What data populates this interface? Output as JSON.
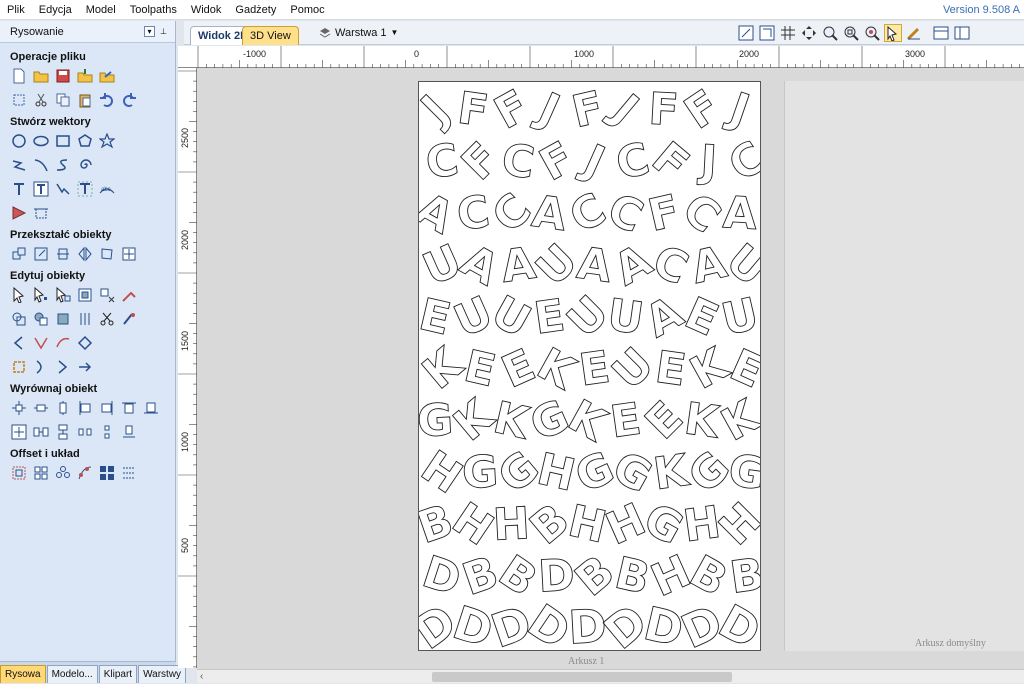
{
  "menu": {
    "items": [
      "Plik",
      "Edycja",
      "Model",
      "Toolpaths",
      "Widok",
      "Gadżety",
      "Pomoc"
    ],
    "version": "Version 9.508 A"
  },
  "panel": {
    "title": "Rysowanie",
    "sections": [
      {
        "title": "Operacje pliku"
      },
      {
        "title": "Stwórz wektory"
      },
      {
        "title": "Przekształć obiekty"
      },
      {
        "title": "Edytuj obiekty"
      },
      {
        "title": "Wyrównaj obiekt"
      },
      {
        "title": "Offset i układ"
      }
    ],
    "tabs": [
      "Rysowa",
      "Modelo...",
      "Klipart",
      "Warstwy"
    ]
  },
  "view": {
    "tab_2d": "Widok 2D",
    "tab_3d": "3D View",
    "layer": "Warstwa 1"
  },
  "ruler": {
    "h_labels": [
      "-1000",
      "0",
      "1000",
      "2000",
      "3000"
    ],
    "v_labels": [
      "2500",
      "2000",
      "1500",
      "1000",
      "500"
    ]
  },
  "canvas": {
    "sheet1": "Arkusz 1",
    "sheet_default": "Arkusz domyślny",
    "letter_rows": [
      "JFFJFJFFJ",
      "CFCFJCFJC",
      "ACCACCFCA",
      "UAAUAACAU",
      "EUUEUUAEU",
      "KEEKEUEKE",
      "GKKGKEEKK",
      "HGGHGGKGG",
      "BHHBHHGHH",
      "DBBDBBHBB",
      "DDDDDDDDD"
    ]
  },
  "colors": {
    "accent": "#3b6fb3",
    "active_tab": "#ffd878",
    "panel_bg": "#dbe7f6"
  }
}
